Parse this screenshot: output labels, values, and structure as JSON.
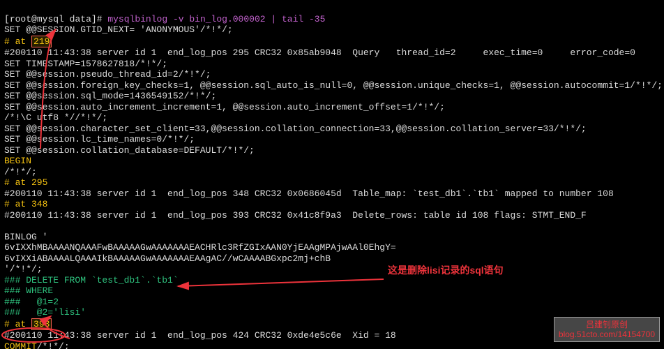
{
  "prompt": {
    "user": "root",
    "host": "mysql",
    "dir": "data",
    "symbol": "#"
  },
  "command": "mysqlbinlog -v bin_log.000002 | tail -35",
  "lines": {
    "l1": "SET @@SESSION.GTID_NEXT= 'ANONYMOUS'/*!*/;",
    "l2_prefix": "# at ",
    "l2_num": "219",
    "l3": "#200110 11:43:38 server id 1  end_log_pos 295 CRC32 0x85ab9048  Query   thread_id=2     exec_time=0     error_code=0",
    "l4": "SET TIMESTAMP=1578627818/*!*/;",
    "l5": "SET @@session.pseudo_thread_id=2/*!*/;",
    "l6": "SET @@session.foreign_key_checks=1, @@session.sql_auto_is_null=0, @@session.unique_checks=1, @@session.autocommit=1/*!*/;",
    "l7": "SET @@session.sql_mode=1436549152/*!*/;",
    "l8": "SET @@session.auto_increment_increment=1, @@session.auto_increment_offset=1/*!*/;",
    "l9": "/*!\\C utf8 *//*!*/;",
    "l10": "SET @@session.character_set_client=33,@@session.collation_connection=33,@@session.collation_server=33/*!*/;",
    "l11": "SET @@session.lc_time_names=0/*!*/;",
    "l12": "SET @@session.collation_database=DEFAULT/*!*/;",
    "l13": "BEGIN",
    "l14": "/*!*/;",
    "l15": "# at 295",
    "l16": "#200110 11:43:38 server id 1  end_log_pos 348 CRC32 0x0686045d  Table_map: `test_db1`.`tb1` mapped to number 108",
    "l17": "# at 348",
    "l18": "#200110 11:43:38 server id 1  end_log_pos 393 CRC32 0x41c8f9a3  Delete_rows: table id 108 flags: STMT_END_F",
    "l19": "",
    "l20": "BINLOG '",
    "l21": "6vIXXhMBAAAANQAAAFwBAAAAAGwAAAAAAAEACHRlc3RfZGIxAAN0YjEAAgMPAjwAAl0EhgY=",
    "l22": "6vIXXiABAAAALQAAAIkBAAAAAGwAAAAAAAEAAgAC//wCAAAABGxpc2mj+chB",
    "l23": "'/*!*/;",
    "l24": "### DELETE FROM `test_db1`.`tb1`",
    "l25": "### WHERE",
    "l26": "###   @1=2",
    "l27": "###   @2='lisi'",
    "l28_prefix": "# at ",
    "l28_num": "393",
    "l29": "#200110 11:43:38 server id 1  end_log_pos 424 CRC32 0xde4e5c6e  Xid = 18",
    "l30_a": "COMMIT",
    "l30_b": "/*!*/;"
  },
  "annotation": "这是删除lisi记录的sql语句",
  "watermark": {
    "line1": "吕建钊原创",
    "line2": "blog.51cto.com/14154700"
  },
  "colors": {
    "bg": "#000000",
    "fg": "#dcdcdc",
    "yellow": "#f5c211",
    "green": "#2ec27e",
    "pink": "#c061cb",
    "red": "#ed333b"
  }
}
